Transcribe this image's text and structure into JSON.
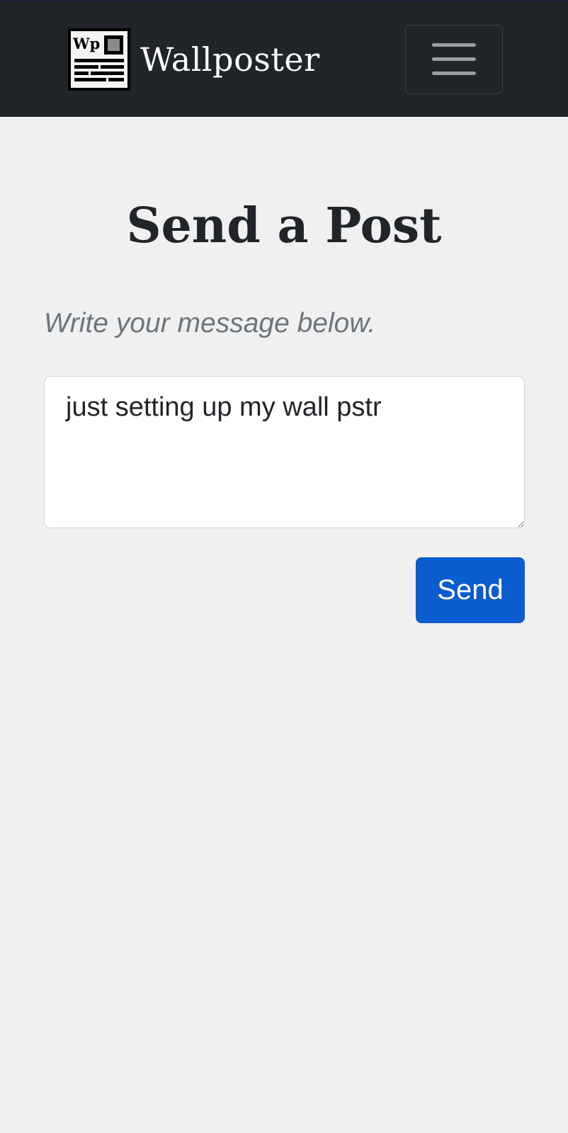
{
  "navbar": {
    "brand_name": "Wallposter",
    "logo_monogram": "Wp",
    "menu_icon": "hamburger-menu-icon"
  },
  "main": {
    "title": "Send a Post",
    "lead": "Write your message below.",
    "message_value": "just setting up my wall pstr",
    "send_label": "Send"
  },
  "colors": {
    "navbar_bg": "#212529",
    "page_bg": "#f0f0f0",
    "primary": "#0b5ccf",
    "muted_text": "#6c757d",
    "heading_text": "#212529"
  }
}
